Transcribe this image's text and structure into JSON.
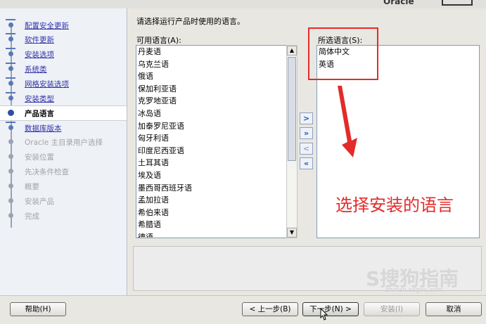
{
  "window": {
    "title_partial": "Oracle"
  },
  "steps": [
    {
      "label": "配置安全更新",
      "state": "done"
    },
    {
      "label": "软件更新",
      "state": "done"
    },
    {
      "label": "安装选项",
      "state": "done"
    },
    {
      "label": "系统类",
      "state": "done"
    },
    {
      "label": "网格安装选项",
      "state": "done"
    },
    {
      "label": "安装类型",
      "state": "done"
    },
    {
      "label": "产品语言",
      "state": "current"
    },
    {
      "label": "数据库版本",
      "state": "next"
    },
    {
      "label": "Oracle 主目录用户选择",
      "state": "pending"
    },
    {
      "label": "安装位置",
      "state": "pending"
    },
    {
      "label": "先决条件检查",
      "state": "pending"
    },
    {
      "label": "概要",
      "state": "pending"
    },
    {
      "label": "安装产品",
      "state": "pending"
    },
    {
      "label": "完成",
      "state": "pending"
    }
  ],
  "main": {
    "instruction": "请选择运行产品时使用的语言。",
    "available_label": "可用语言(A):",
    "selected_label": "所选语言(S):",
    "available_languages": [
      "丹麦语",
      "乌克兰语",
      "俄语",
      "保加利亚语",
      "克罗地亚语",
      "冰岛语",
      "加泰罗尼亚语",
      "匈牙利语",
      "印度尼西亚语",
      "土耳其语",
      "埃及语",
      "墨西哥西班牙语",
      "孟加拉语",
      "希伯来语",
      "希腊语",
      "德语"
    ],
    "selected_languages": [
      "简体中文",
      "英语"
    ],
    "move_buttons": [
      ">",
      "»",
      "<",
      "«"
    ]
  },
  "annotation": {
    "text": "选择安装的语言",
    "color": "#e32b2b"
  },
  "watermark": {
    "text": "S搜狗指南",
    "url": "zhinan.sogou.com"
  },
  "buttons": {
    "help": "帮助(H)",
    "back": "< 上一步(B)",
    "next": "下一步(N) >",
    "install": "安装(I)",
    "cancel": "取消"
  }
}
